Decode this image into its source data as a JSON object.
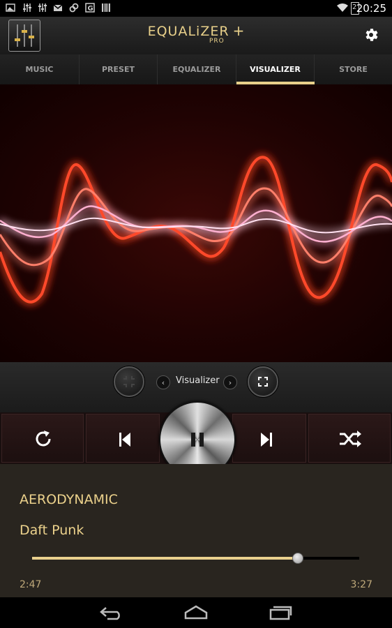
{
  "status_bar": {
    "time": "20:25",
    "battery_level": "2",
    "icons": [
      "gallery-icon",
      "equalizer-icon",
      "equalizer-icon",
      "gmail-icon",
      "link-icon",
      "g-icon",
      "barcode-icon",
      "wifi-icon",
      "battery-icon"
    ]
  },
  "header": {
    "title": "EQUALiZER",
    "title_plus": "+",
    "subtitle": "PRO",
    "icons": [
      "app-logo-icon",
      "settings-icon"
    ]
  },
  "tabs": [
    {
      "label": "MUSIC"
    },
    {
      "label": "PRESET"
    },
    {
      "label": "EQUALIZER"
    },
    {
      "label": "VISUALIZER",
      "active": true
    },
    {
      "label": "STORE"
    }
  ],
  "visualizer_control": {
    "label": "Visualizer",
    "icons": [
      "minimize-icon",
      "chevron-left-icon",
      "chevron-right-icon",
      "fullscreen-icon"
    ]
  },
  "transport": {
    "icons": [
      "repeat-icon",
      "previous-icon",
      "pause-icon",
      "next-icon",
      "shuffle-icon"
    ]
  },
  "now_playing": {
    "title": "AERODYNAMIC",
    "artist": "Daft Punk",
    "elapsed": "2:47",
    "total": "3:27",
    "progress": 0.81
  },
  "nav_bar": {
    "icons": [
      "back-icon",
      "home-icon",
      "recents-icon"
    ]
  },
  "colors": {
    "accent": "#e8d08a",
    "wave": "#ff3b1f",
    "background": "#29251f"
  }
}
